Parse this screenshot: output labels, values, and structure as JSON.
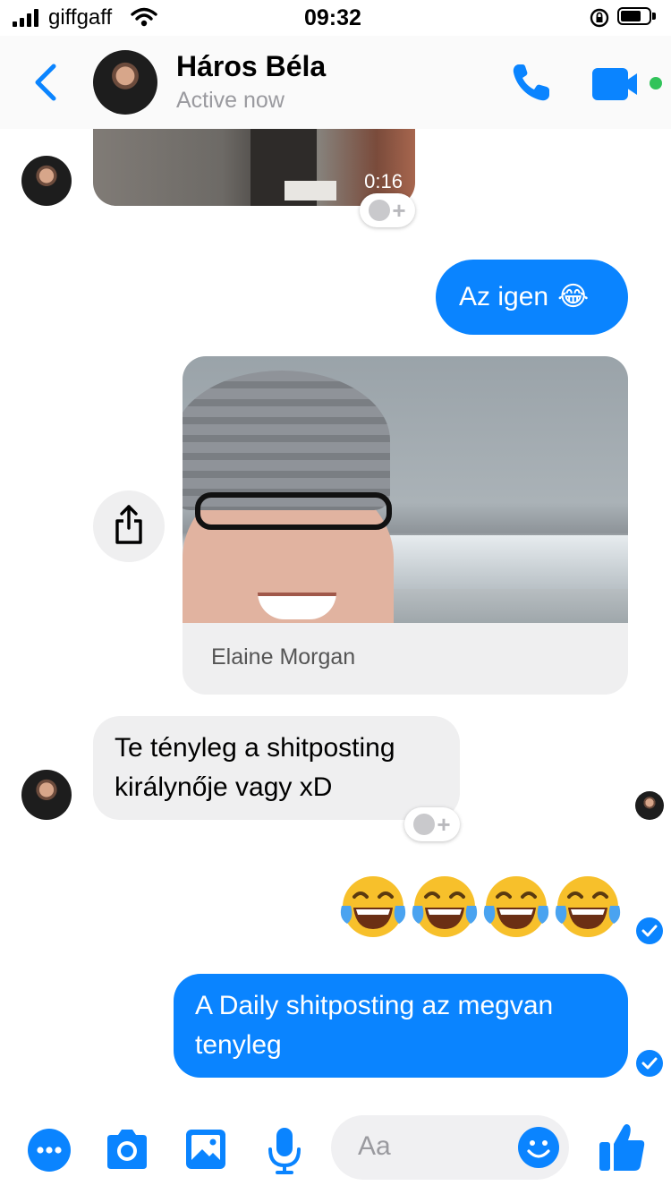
{
  "status_bar": {
    "carrier": "giffgaff",
    "time": "09:32"
  },
  "header": {
    "contact_name": "Háros Béla",
    "presence": "Active now"
  },
  "video_message": {
    "duration": "0:16"
  },
  "messages": [
    {
      "direction": "outgoing",
      "text": "Az igen",
      "emoji": "😂"
    },
    {
      "direction": "outgoing",
      "type": "shared-image",
      "caption": "Elaine Morgan"
    },
    {
      "direction": "incoming",
      "text_lines": [
        "Te tényleg a shitposting",
        "királynője vagy xD"
      ]
    },
    {
      "direction": "outgoing",
      "type": "emoji-only",
      "emoji": [
        "😂",
        "😂",
        "😂",
        "😂"
      ]
    },
    {
      "direction": "outgoing",
      "text_lines": [
        "A Daily shitposting az megvan",
        "tenyleg"
      ]
    }
  ],
  "composer": {
    "placeholder": "Aa"
  },
  "colors": {
    "accent": "#0a84ff",
    "incoming_bubble": "#efeff0",
    "online_dot": "#31c35a"
  }
}
